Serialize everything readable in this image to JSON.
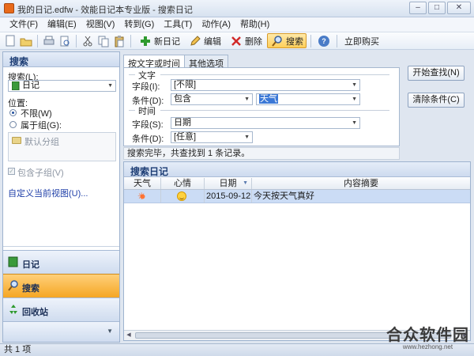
{
  "window": {
    "title": "我的日记.edfw - 效能日记本专业版 - 搜索日记",
    "btn_min": "–",
    "btn_max": "□",
    "btn_close": "✕"
  },
  "menu": [
    "文件(F)",
    "编辑(E)",
    "视图(V)",
    "转到(G)",
    "工具(T)",
    "动作(A)",
    "帮助(H)"
  ],
  "toolbar": {
    "new_diary": "新日记",
    "edit": "编辑",
    "delete": "删除",
    "search": "搜索",
    "buy_now": "立即购买"
  },
  "left_panel": {
    "title": "搜索",
    "search_label": "搜索(L):",
    "search_value": "日记",
    "position_label": "位置:",
    "opt_unlimited": "不限(W)",
    "opt_in_group": "属于组(G):",
    "default_group": "默认分组",
    "include_subgroup": "包含子组(V)",
    "custom_view_link": "自定义当前视图(U)...",
    "nav": {
      "diary": "日记",
      "search": "搜索",
      "recycle": "回收站"
    }
  },
  "search_panel": {
    "tab_text_time": "按文字或时间",
    "tab_other": "其他选项",
    "section_text": "文字",
    "field_label": "字段(I):",
    "field_value": "[不限]",
    "condition_label": "条件(D):",
    "condition_value": "包含",
    "keyword_value": "天气",
    "section_time": "时间",
    "time_field_label": "字段(S):",
    "time_field_value": "日期",
    "time_condition_label": "条件(D):",
    "time_condition_value": "[任意]",
    "start_search": "开始查找(N)",
    "clear_conditions": "清除条件(C)",
    "status": "搜索完毕，共查找到 1 条记录。"
  },
  "results": {
    "title": "搜索日记",
    "columns": [
      "天气",
      "心情",
      "日期",
      "内容摘要"
    ],
    "rows": [
      {
        "weather": "sun-icon",
        "mood": "smile-icon",
        "date": "2015-09-12",
        "summary": "今天按天气真好"
      }
    ]
  },
  "statusbar": {
    "text": "共 1 项"
  },
  "watermark": {
    "main": "合众软件园",
    "url": "www.hezhong.net"
  }
}
